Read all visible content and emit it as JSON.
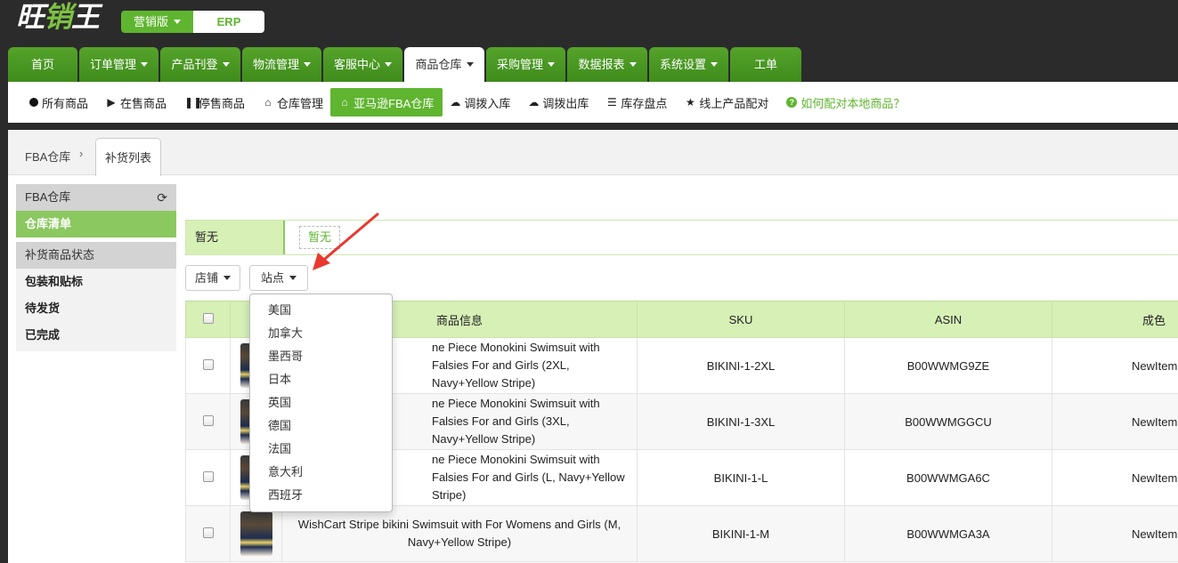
{
  "header": {
    "logo_text": "旺销王",
    "edition_label": "营销版",
    "erp_label": "ERP"
  },
  "main_nav": [
    {
      "label": "首页",
      "dropdown": false
    },
    {
      "label": "订单管理",
      "dropdown": true
    },
    {
      "label": "产品刊登",
      "dropdown": true
    },
    {
      "label": "物流管理",
      "dropdown": true
    },
    {
      "label": "客服中心",
      "dropdown": true
    },
    {
      "label": "商品仓库",
      "dropdown": true,
      "active": true
    },
    {
      "label": "采购管理",
      "dropdown": true
    },
    {
      "label": "数据报表",
      "dropdown": true
    },
    {
      "label": "系统设置",
      "dropdown": true
    },
    {
      "label": "工单",
      "dropdown": false
    }
  ],
  "sub_nav": [
    {
      "label": "所有商品",
      "icon": "circle-icon"
    },
    {
      "label": "在售商品",
      "icon": "play-icon"
    },
    {
      "label": "停售商品",
      "icon": "pause-icon"
    },
    {
      "label": "仓库管理",
      "icon": "home-icon"
    },
    {
      "label": "亚马逊FBA仓库",
      "icon": "home-icon",
      "active": true
    },
    {
      "label": "调拨入库",
      "icon": "cloud-upload-icon"
    },
    {
      "label": "调拨出库",
      "icon": "cloud-download-icon"
    },
    {
      "label": "库存盘点",
      "icon": "list-icon"
    },
    {
      "label": "线上产品配对",
      "icon": "star-icon"
    },
    {
      "label": "如何配对本地商品？",
      "icon": "help-icon",
      "help": true
    }
  ],
  "breadcrumb": {
    "parent": "FBA仓库",
    "separator": "›",
    "current_tab": "补货列表"
  },
  "sidebar": {
    "section1_title": "FBA仓库",
    "section1_active_item": "仓库清单",
    "section2_title": "补货商品状态",
    "section2_items": [
      "包装和贴标",
      "待发货",
      "已完成"
    ]
  },
  "filter": {
    "label": "暂无",
    "tag": "暂无"
  },
  "buttons": {
    "shop": "店铺",
    "site": "站点"
  },
  "site_dropdown": [
    "美国",
    "加拿大",
    "墨西哥",
    "日本",
    "英国",
    "德国",
    "法国",
    "意大利",
    "西班牙"
  ],
  "table": {
    "headers": [
      "",
      "",
      "商品信息",
      "SKU",
      "ASIN",
      "成色"
    ],
    "rows": [
      {
        "name": "ne Piece Monokini Swimsuit with Falsies For and Girls (2XL, Navy+Yellow Stripe)",
        "sku": "BIKINI-1-2XL",
        "asin": "B00WWMG9ZE",
        "condition": "NewItem"
      },
      {
        "name": "ne Piece Monokini Swimsuit with Falsies For and Girls (3XL, Navy+Yellow Stripe)",
        "sku": "BIKINI-1-3XL",
        "asin": "B00WWMGGCU",
        "condition": "NewItem"
      },
      {
        "name": "ne Piece Monokini Swimsuit with Falsies For and Girls (L, Navy+Yellow Stripe)",
        "sku": "BIKINI-1-L",
        "asin": "B00WWMGA6C",
        "condition": "NewItem"
      },
      {
        "name": "WishCart Stripe bikini Swimsuit with For Womens and Girls (M, Navy+Yellow Stripe)",
        "sku": "BIKINI-1-M",
        "asin": "B00WWMGA3A",
        "condition": "NewItem"
      }
    ]
  },
  "colors": {
    "brand_green": "#5fb52f",
    "header_bg": "#2b2b2b",
    "table_header_bg": "#d6f0b6",
    "annotation_red": "#e8392f"
  }
}
